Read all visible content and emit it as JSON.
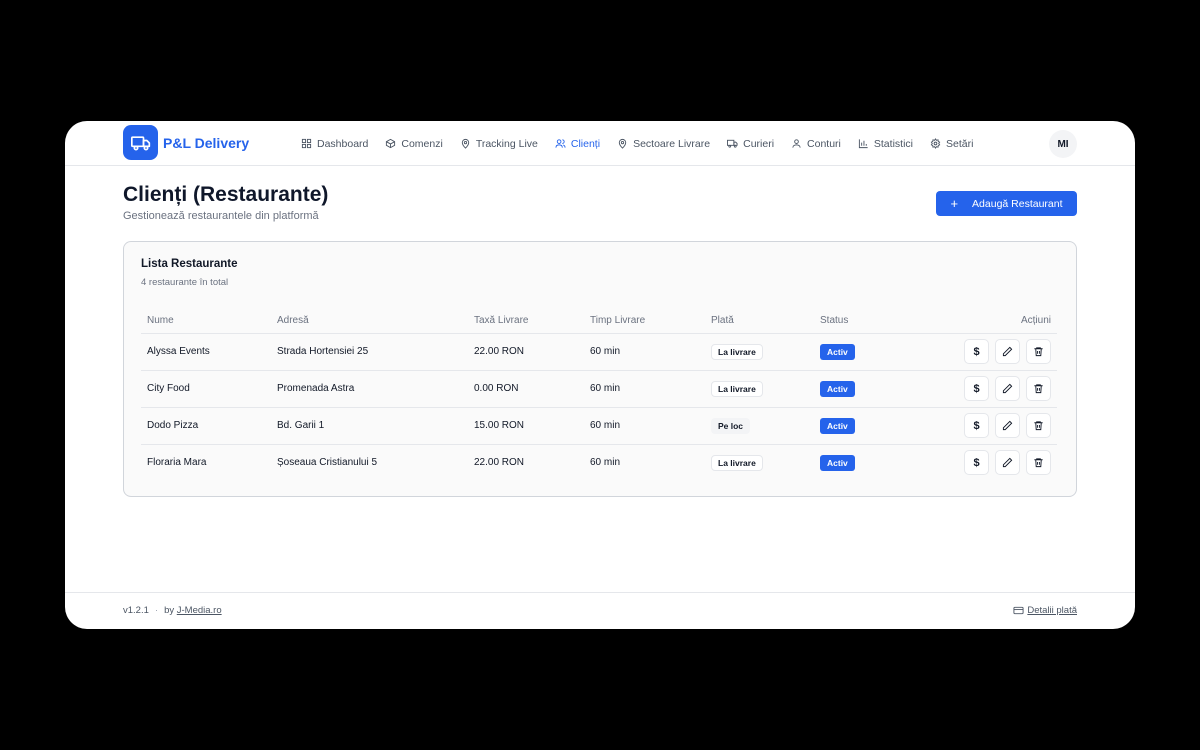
{
  "brand": {
    "name": "P&L Delivery",
    "logo_icon": "truck-icon",
    "accent": "#2563eb"
  },
  "nav": [
    {
      "label": "Dashboard",
      "icon": "grid-icon",
      "active": false
    },
    {
      "label": "Comenzi",
      "icon": "box-icon",
      "active": false
    },
    {
      "label": "Tracking Live",
      "icon": "map-pin-icon",
      "active": false
    },
    {
      "label": "Clienți",
      "icon": "users-icon",
      "active": true
    },
    {
      "label": "Sectoare Livrare",
      "icon": "map-pin-icon",
      "active": false
    },
    {
      "label": "Curieri",
      "icon": "truck-icon",
      "active": false
    },
    {
      "label": "Conturi",
      "icon": "user-icon",
      "active": false
    },
    {
      "label": "Statistici",
      "icon": "bar-chart-icon",
      "active": false
    },
    {
      "label": "Setări",
      "icon": "gear-icon",
      "active": false
    }
  ],
  "user": {
    "initials": "MI"
  },
  "page": {
    "title": "Clienți (Restaurante)",
    "subtitle": "Gestionează restaurantele din platformă",
    "add_button": "Adaugă Restaurant"
  },
  "card": {
    "title": "Lista Restaurante",
    "subtitle": "4 restaurante în total"
  },
  "table": {
    "headers": [
      "Nume",
      "Adresă",
      "Taxă Livrare",
      "Timp Livrare",
      "Plată",
      "Status",
      "Acțiuni"
    ],
    "rows": [
      {
        "name": "Alyssa Events",
        "address": "Strada Hortensiei 25",
        "fee": "22.00 RON",
        "time": "60 min",
        "payment": "La livrare",
        "status": "Activ"
      },
      {
        "name": "City Food",
        "address": "Promenada Astra",
        "fee": "0.00 RON",
        "time": "60 min",
        "payment": "La livrare",
        "status": "Activ"
      },
      {
        "name": "Dodo Pizza",
        "address": "Bd. Garii 1",
        "fee": "15.00 RON",
        "time": "60 min",
        "payment": "Pe loc",
        "status": "Activ"
      },
      {
        "name": "Floraria Mara",
        "address": "Șoseaua Cristianului 5",
        "fee": "22.00 RON",
        "time": "60 min",
        "payment": "La livrare",
        "status": "Activ"
      }
    ],
    "action_icons": [
      "dollar-icon",
      "pencil-icon",
      "trash-icon"
    ],
    "dollar_symbol": "$"
  },
  "footer": {
    "version": "v1.2.1",
    "separator": "·",
    "by_text": "by",
    "by_link": "J-Media.ro",
    "payment_link": "Detalii plată",
    "payment_icon": "credit-card-icon"
  }
}
